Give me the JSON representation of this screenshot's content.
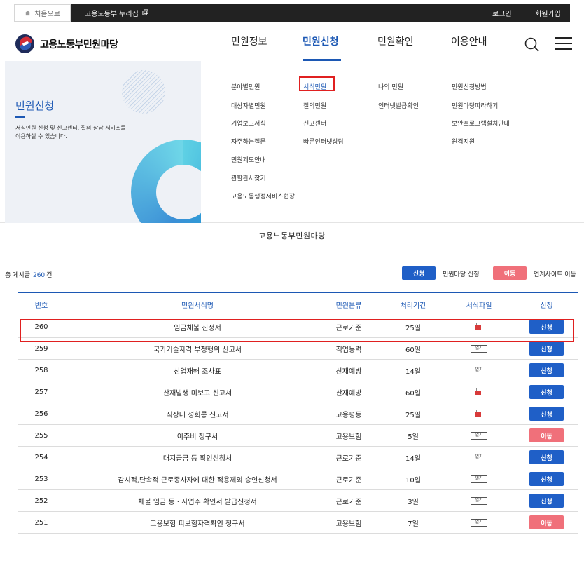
{
  "topbar": {
    "home_label": "처음으로",
    "nuri_label": "고용노동부 누리집",
    "login_label": "로그인",
    "join_label": "회원가입"
  },
  "header": {
    "site_name": "고용노동부민원마당",
    "nav": [
      {
        "label": "민원정보",
        "active": false
      },
      {
        "label": "민원신청",
        "active": true
      },
      {
        "label": "민원확인",
        "active": false
      },
      {
        "label": "이용안내",
        "active": false
      }
    ]
  },
  "mega": {
    "section_title": "민원신청",
    "section_desc": "서식민원 신청 및 신고센터, 질의·상담 서비스를 이용하실 수 있습니다.",
    "col1": [
      "분야별민원",
      "대상자별민원",
      "기업보고서식",
      "자주하는질문",
      "민원제도안내",
      "관할관서찾기",
      "고용노동행정서비스현장"
    ],
    "col2": [
      "서식민원",
      "질의민원",
      "신고센터",
      "빠른인터넷상담"
    ],
    "col3": [
      "나의 민원",
      "인터넷발급확인"
    ],
    "col4": [
      "민원신청방법",
      "민원마당따라하기",
      "보안프로그램설치안내",
      "원격지원"
    ],
    "selected": "서식민원"
  },
  "center_title": "고용노동부민원마당",
  "summary": {
    "total_prefix": "총 게시글",
    "total_count": "260",
    "total_suffix": "건",
    "legend_apply_btn": "신청",
    "legend_apply_text": "민원마당 신청",
    "legend_move_btn": "이동",
    "legend_move_text": "연계사이트 이동"
  },
  "colors": {
    "accent": "#1c58b4",
    "apply_button": "#1f5fc7",
    "move_button": "#f0707a",
    "highlight_box": "#e02020"
  },
  "table": {
    "headers": [
      "번호",
      "민원서식명",
      "민원분류",
      "처리기간",
      "서식파일",
      "신청"
    ],
    "rows": [
      {
        "no": "260",
        "name": "임금체불 진정서",
        "category": "근로기준",
        "days": "25일",
        "file": "hwp-icon",
        "action": "신청"
      },
      {
        "no": "259",
        "name": "국가기술자격 부정행위 신고서",
        "category": "직업능력",
        "days": "60일",
        "file": "열기",
        "action": "신청"
      },
      {
        "no": "258",
        "name": "산업재해 조사표",
        "category": "산재예방",
        "days": "14일",
        "file": "열기",
        "action": "신청"
      },
      {
        "no": "257",
        "name": "산재발생 미보고 신고서",
        "category": "산재예방",
        "days": "60일",
        "file": "hwp-icon",
        "action": "신청"
      },
      {
        "no": "256",
        "name": "직장내 성희롱 신고서",
        "category": "고용평등",
        "days": "25일",
        "file": "hwp-icon",
        "action": "신청"
      },
      {
        "no": "255",
        "name": "이주비 청구서",
        "category": "고용보험",
        "days": "5일",
        "file": "열기",
        "action": "이동"
      },
      {
        "no": "254",
        "name": "대지급금 등 확인신청서",
        "category": "근로기준",
        "days": "14일",
        "file": "열기",
        "action": "신청"
      },
      {
        "no": "253",
        "name": "감시적,단속적 근로종사자에 대한 적용제외 승인신청서",
        "category": "근로기준",
        "days": "10일",
        "file": "열기",
        "action": "신청"
      },
      {
        "no": "252",
        "name": "체불 임금 등 · 사업주 확인서 발급신청서",
        "category": "근로기준",
        "days": "3일",
        "file": "열기",
        "action": "신청"
      },
      {
        "no": "251",
        "name": "고용보험 피보험자격확인 청구서",
        "category": "고용보험",
        "days": "7일",
        "file": "열기",
        "action": "이동"
      }
    ]
  }
}
